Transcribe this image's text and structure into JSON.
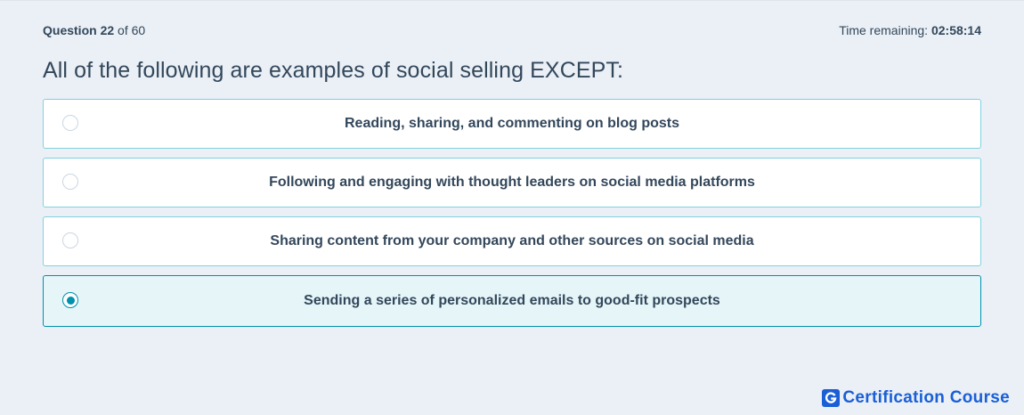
{
  "header": {
    "question_label": "Question",
    "question_number": "22",
    "question_of": "of 60",
    "time_label": "Time remaining:",
    "time_value": "02:58:14"
  },
  "question": {
    "text": "All of the following are examples of social selling EXCEPT:"
  },
  "options": [
    {
      "text": "Reading, sharing, and commenting on blog posts",
      "selected": false
    },
    {
      "text": "Following and engaging with thought leaders on social media platforms",
      "selected": false
    },
    {
      "text": "Sharing content from your company and other sources on social media",
      "selected": false
    },
    {
      "text": "Sending a series of personalized emails to good-fit prospects",
      "selected": true
    }
  ],
  "brand": {
    "logo_letter": "G",
    "name": "Certification Course",
    "color": "#1a5fd6"
  },
  "colors": {
    "accent": "#0091ae",
    "text": "#33475b",
    "background": "#eaf0f6"
  }
}
